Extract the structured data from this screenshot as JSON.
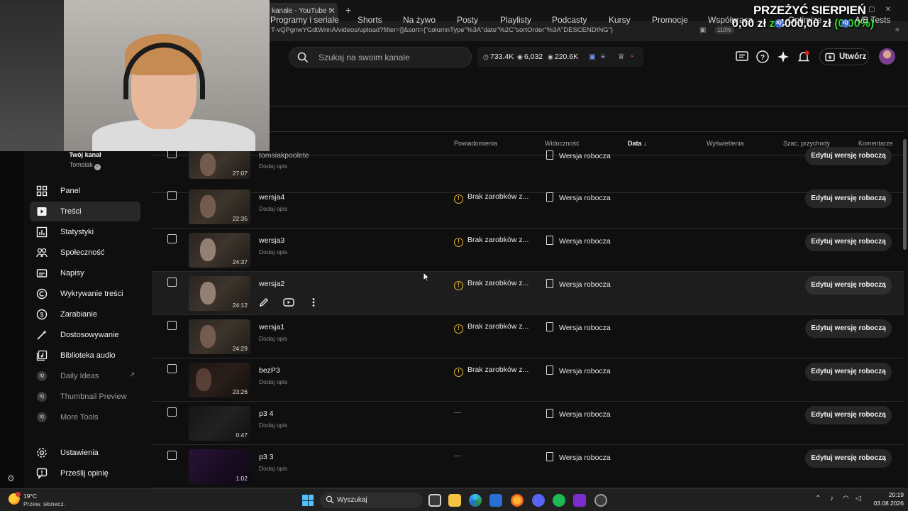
{
  "browser": {
    "tab_title": "kanale - YouTube Studio",
    "address": "T-vQPgnwYGdtWnnA/videos/upload?filter=[]&sort={\"columnType\"%3A\"date\"%2C\"sortOrder\"%3A\"DESCENDING\"}",
    "zoom": "110%"
  },
  "overlay": {
    "title": "PRZEŻYĆ SIERPIEŃ",
    "current": "0,00 zł",
    "separator": "z",
    "goal": "4000,00 zł",
    "percent": "(0.00%)",
    "colors": {
      "accent": "#2cd62c"
    }
  },
  "header": {
    "search_placeholder": "Szukaj na swoim kanale",
    "stats": {
      "subs": "733.4K",
      "views_a": "6,032",
      "views_b": "220.6K"
    },
    "create_label": "Utwórz"
  },
  "subtabs": [
    {
      "label": "Programy i seriale"
    },
    {
      "label": "Shorts"
    },
    {
      "label": "Na żywo"
    },
    {
      "label": "Posty"
    },
    {
      "label": "Playlisty"
    },
    {
      "label": "Podcasty"
    },
    {
      "label": "Kursy"
    },
    {
      "label": "Promocje"
    },
    {
      "label": "Współpraca"
    },
    {
      "label": "Optimize",
      "badge": "IQ"
    },
    {
      "label": "A/B Tests",
      "badge": "IQ"
    }
  ],
  "sidebar": {
    "channel_label": "Twój kanał",
    "channel_name": "Tomsiak",
    "items": [
      {
        "label": "Panel",
        "icon": "dashboard-icon"
      },
      {
        "label": "Treści",
        "icon": "content-icon",
        "active": true
      },
      {
        "label": "Statystyki",
        "icon": "analytics-icon"
      },
      {
        "label": "Społeczność",
        "icon": "community-icon"
      },
      {
        "label": "Napisy",
        "icon": "subtitles-icon"
      },
      {
        "label": "Wykrywanie treści",
        "icon": "copyright-icon"
      },
      {
        "label": "Zarabianie",
        "icon": "earn-icon"
      },
      {
        "label": "Dostosowywanie",
        "icon": "customization-icon"
      },
      {
        "label": "Biblioteka audio",
        "icon": "audio-library-icon"
      },
      {
        "label": "Daily Ideas",
        "icon": "iq-icon",
        "ext": true
      },
      {
        "label": "Thumbnail Preview",
        "icon": "iq-icon"
      },
      {
        "label": "More Tools",
        "icon": "iq-icon"
      }
    ],
    "bottom": [
      {
        "label": "Ustawienia",
        "icon": "settings-icon"
      },
      {
        "label": "Prześlij opinię",
        "icon": "feedback-icon"
      }
    ]
  },
  "table": {
    "headers": {
      "notifications": "Powiadomienia",
      "visibility": "Widoczność",
      "date": "Data",
      "views": "Wyświetlenia",
      "revenue": "Szac. przychody",
      "comments": "Komentarze"
    },
    "rows": [
      {
        "title": "tomsiakpoolete",
        "desc": "Dodaj opis",
        "duration": "27:07",
        "restriction": "",
        "visibility": "Wersja robocza",
        "action": "Edytuj wersję roboczą"
      },
      {
        "title": "wersja4",
        "desc": "Dodaj opis",
        "duration": "22:35",
        "restriction": "Brak zarobków z...",
        "visibility": "Wersja robocza",
        "action": "Edytuj wersję roboczą"
      },
      {
        "title": "wersja3",
        "desc": "Dodaj opis",
        "duration": "24:37",
        "restriction": "Brak zarobków z...",
        "visibility": "Wersja robocza",
        "action": "Edytuj wersję roboczą"
      },
      {
        "title": "wersja2",
        "desc": "",
        "duration": "24:12",
        "restriction": "Brak zarobków z...",
        "visibility": "Wersja robocza",
        "action": "Edytuj wersję roboczą",
        "hover": true
      },
      {
        "title": "wersja1",
        "desc": "Dodaj opis",
        "duration": "24:29",
        "restriction": "Brak zarobków z...",
        "visibility": "Wersja robocza",
        "action": "Edytuj wersję roboczą"
      },
      {
        "title": "bezP3",
        "desc": "Dodaj opis",
        "duration": "23:26",
        "restriction": "Brak zarobków z...",
        "visibility": "Wersja robocza",
        "action": "Edytuj wersję roboczą"
      },
      {
        "title": "p3 4",
        "desc": "Dodaj opis",
        "duration": "0:47",
        "restriction": "—",
        "visibility": "Wersja robocza",
        "action": "Edytuj wersję roboczą"
      },
      {
        "title": "p3 3",
        "desc": "Dodaj opis",
        "duration": "1:02",
        "restriction": "—",
        "visibility": "Wersja robocza",
        "action": "Edytuj wersję roboczą"
      }
    ]
  },
  "taskbar": {
    "temp": "19°C",
    "weather": "Przew. słonecz.",
    "search_label": "Wyszukaj",
    "time": "20:19",
    "date": "03.08.2026"
  }
}
